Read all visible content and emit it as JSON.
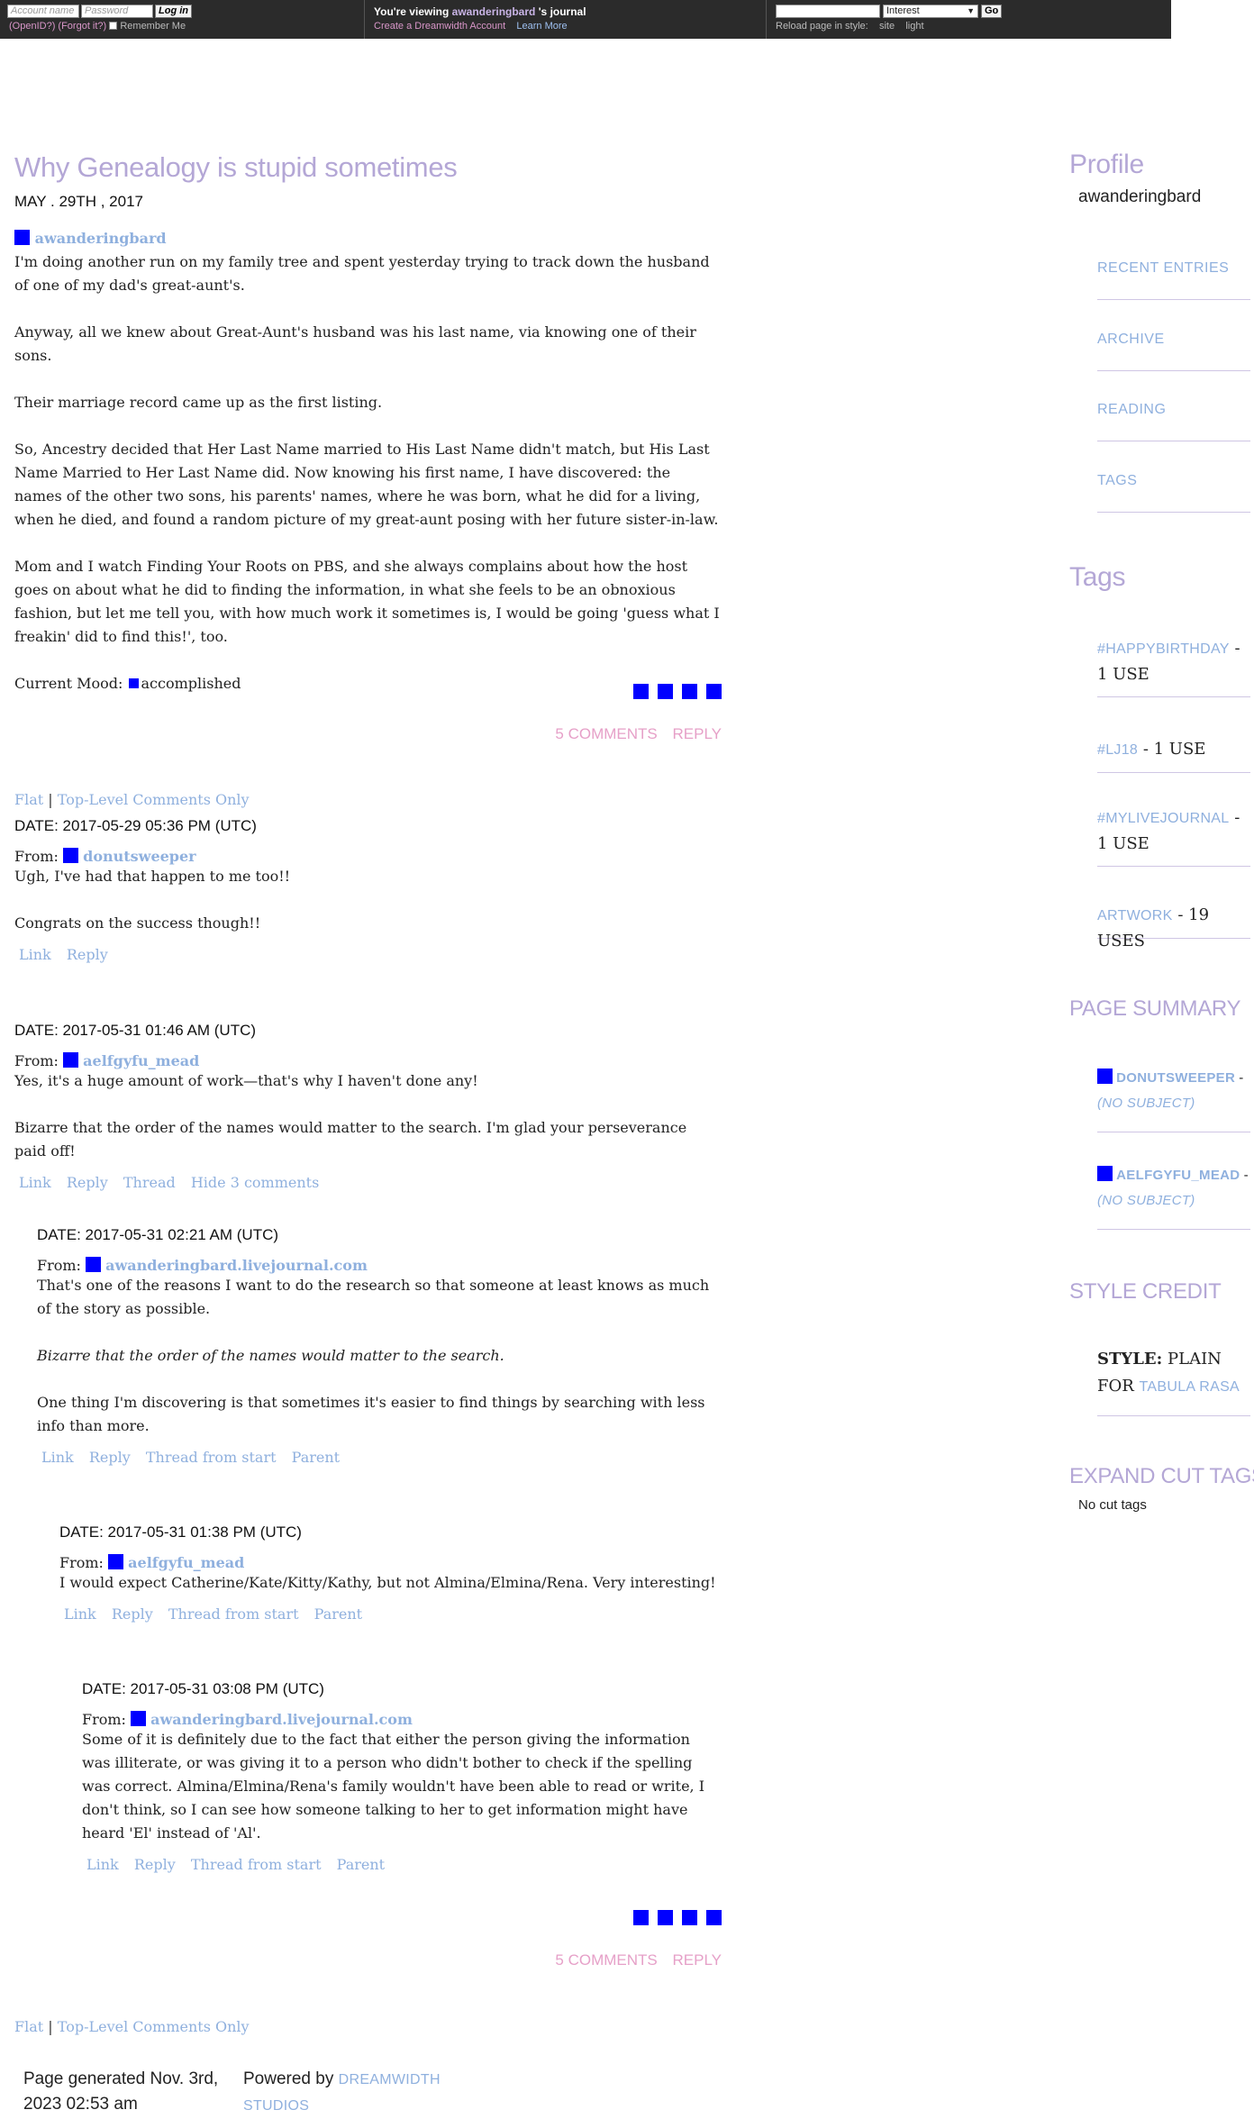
{
  "topbar": {
    "account_placeholder": "Account name",
    "password_placeholder": "Password",
    "login_button": "Log in",
    "openid_link": "(OpenID?)",
    "forgot_link": "(Forgot it?)",
    "remember_label": "Remember Me",
    "viewing_prefix": "You're viewing",
    "viewing_user": "awanderingbard",
    "viewing_suffix": "'s journal",
    "create_account": "Create a Dreamwidth Account",
    "learn_more": "Learn More",
    "search_select": "Interest",
    "go_button": "Go",
    "reload_label": "Reload page in style:",
    "style_site": "site",
    "style_light": "light"
  },
  "entry": {
    "title": "Why Genealogy is stupid sometimes",
    "date": "MAY . 29TH , 2017",
    "poster": "awanderingbard",
    "paragraphs": [
      "I'm doing another run on my family tree and spent yesterday trying to track down the husband of one of my dad's great-aunt's.",
      "Anyway, all we knew about Great-Aunt's husband was his last name, via knowing one of their sons.",
      "Their marriage record came up as the first listing.",
      "So, Ancestry decided that Her Last Name married to His Last Name didn't match, but His Last Name Married to Her Last Name did. Now knowing his first name, I have discovered: the names of the other two sons, his parents' names, where he was born, what he did for a living, when he died, and found a random picture of my great-aunt posing with her future sister-in-law.",
      "Mom and I watch Finding Your Roots on PBS, and she always complains about how the host goes on about what he did to finding the information, in what she feels to be an obnoxious fashion, but let me tell you, with how much work it sometimes is, I would be going 'guess what I freakin' did to find this!', too."
    ],
    "mood_label": "Current Mood:",
    "mood_value": "accomplished",
    "comments_link": "5 COMMENTS",
    "reply_link": "REPLY"
  },
  "threading": {
    "flat": "Flat",
    "separator": "|",
    "top_level": "Top-Level Comments Only"
  },
  "comments": [
    {
      "date": "DATE: 2017-05-29 05:36 PM (UTC)",
      "from_label": "From:",
      "user": "donutsweeper",
      "body": [
        "Ugh, I've had that happen to me too!!",
        "Congrats on the success though!!"
      ],
      "actions": [
        "Link",
        "Reply"
      ]
    },
    {
      "date": "DATE: 2017-05-31 01:46 AM (UTC)",
      "from_label": "From:",
      "user": "aelfgyfu_mead",
      "body": [
        "Yes, it's a huge amount of work—that's why I haven't done any!",
        "Bizarre that the order of the names would matter to the search. I'm glad your perseverance paid off!"
      ],
      "actions": [
        "Link",
        "Reply",
        "Thread",
        "Hide 3 comments"
      ]
    },
    {
      "date": "DATE: 2017-05-31 02:21 AM (UTC)",
      "from_label": "From:",
      "user": "awanderingbard.livejournal.com",
      "body": [
        "That's one of the reasons I want to do the research so that someone at least knows as much of the story as possible.",
        "Bizarre that the order of the names would matter to the search.",
        "One thing I'm discovering is that sometimes it's easier to find things by searching with less info than more."
      ],
      "actions": [
        "Link",
        "Reply",
        "Thread from start",
        "Parent"
      ]
    },
    {
      "date": "DATE: 2017-05-31 01:38 PM (UTC)",
      "from_label": "From:",
      "user": "aelfgyfu_mead",
      "body": [
        "I would expect Catherine/Kate/Kitty/Kathy, but not Almina/Elmina/Rena. Very interesting!"
      ],
      "actions": [
        "Link",
        "Reply",
        "Thread from start",
        "Parent"
      ]
    },
    {
      "date": "DATE: 2017-05-31 03:08 PM (UTC)",
      "from_label": "From:",
      "user": "awanderingbard.livejournal.com",
      "body": [
        "Some of it is definitely due to the fact that either the person giving the information was illiterate, or was giving it to a person who didn't bother to check if the spelling was correct. Almina/Elmina/Rena's family wouldn't have been able to read or write, I don't think, so I can see how someone talking to her to get information might have heard 'El' instead of 'Al'."
      ],
      "actions": [
        "Link",
        "Reply",
        "Thread from start",
        "Parent"
      ]
    }
  ],
  "sidebar": {
    "profile_heading": "Profile",
    "username": "awanderingbard",
    "nav": [
      "RECENT ENTRIES",
      "ARCHIVE",
      "READING",
      "TAGS"
    ],
    "tags_heading": "Tags",
    "tags": [
      {
        "name": "#HAPPYBIRTHDAY",
        "uses": "- 1 USE"
      },
      {
        "name": "#LJ18",
        "uses": "- 1 USE"
      },
      {
        "name": "#MYLIVEJOURNAL",
        "uses": "- 1 USE"
      },
      {
        "name": "ARTWORK",
        "uses": "- 19 USES"
      }
    ],
    "summary_heading": "PAGE SUMMARY",
    "summary": [
      {
        "who": "DONUTSWEEPER",
        "dash": " -",
        "subject": "(NO SUBJECT)"
      },
      {
        "who": "AELFGYFU_MEAD",
        "dash": " -",
        "subject": "(NO SUBJECT)"
      }
    ],
    "credit_heading": "STYLE CREDIT",
    "credit_style_label": "STYLE:",
    "credit_style_value": "PLAIN",
    "credit_for": "FOR",
    "credit_link": "TABULA RASA",
    "cut_heading": "EXPAND CUT TAGS",
    "cut_note": "No cut tags"
  },
  "footer": {
    "generated": "Page generated Nov. 3rd, 2023 02:53 am",
    "powered_by": "Powered by",
    "dreamwidth": "DREAMWIDTH STUDIOS"
  },
  "colors": {
    "accent_purple": "#b4a7d6",
    "link_blue": "#8fb0de",
    "link_pink": "#e6a0c8",
    "icon_blue": "#0000ff",
    "topbar_bg": "#2b2b2b"
  }
}
